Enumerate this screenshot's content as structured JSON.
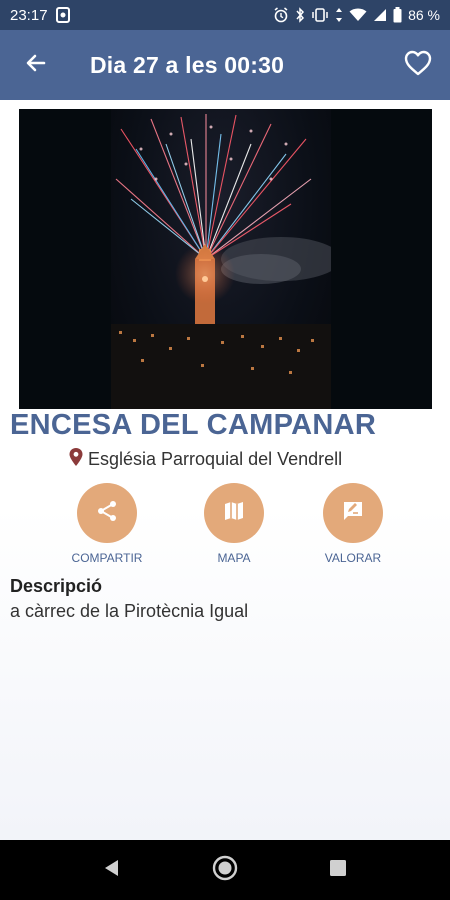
{
  "status_bar": {
    "time": "23:17",
    "battery": "86 %",
    "icons": [
      "alarm-icon",
      "bluetooth-icon",
      "vibrate-icon",
      "data-icon",
      "wifi-icon",
      "signal-icon",
      "battery-icon"
    ]
  },
  "app_bar": {
    "title": "Dia 27 a les 00:30",
    "back_icon": "arrow-back-icon",
    "favorite_icon": "heart-outline-icon"
  },
  "event": {
    "title": "ENCESA DEL CAMPANAR",
    "location": "Església Parroquial del Vendrell",
    "location_icon": "location-pin-icon"
  },
  "actions": [
    {
      "label": "COMPARTIR",
      "icon": "share-icon"
    },
    {
      "label": "MAPA",
      "icon": "map-icon"
    },
    {
      "label": "VALORAR",
      "icon": "rate-icon"
    }
  ],
  "description": {
    "heading": "Descripció",
    "text": "a càrrec de la Pirotècnia Igual"
  },
  "colors": {
    "status_bar": "#2e4467",
    "app_bar": "#4b6594",
    "accent": "#e3a97a",
    "title": "#4b6594",
    "location_pin": "#8b3a3a"
  },
  "nav": [
    "back-triangle-icon",
    "home-circle-icon",
    "recents-square-icon"
  ]
}
